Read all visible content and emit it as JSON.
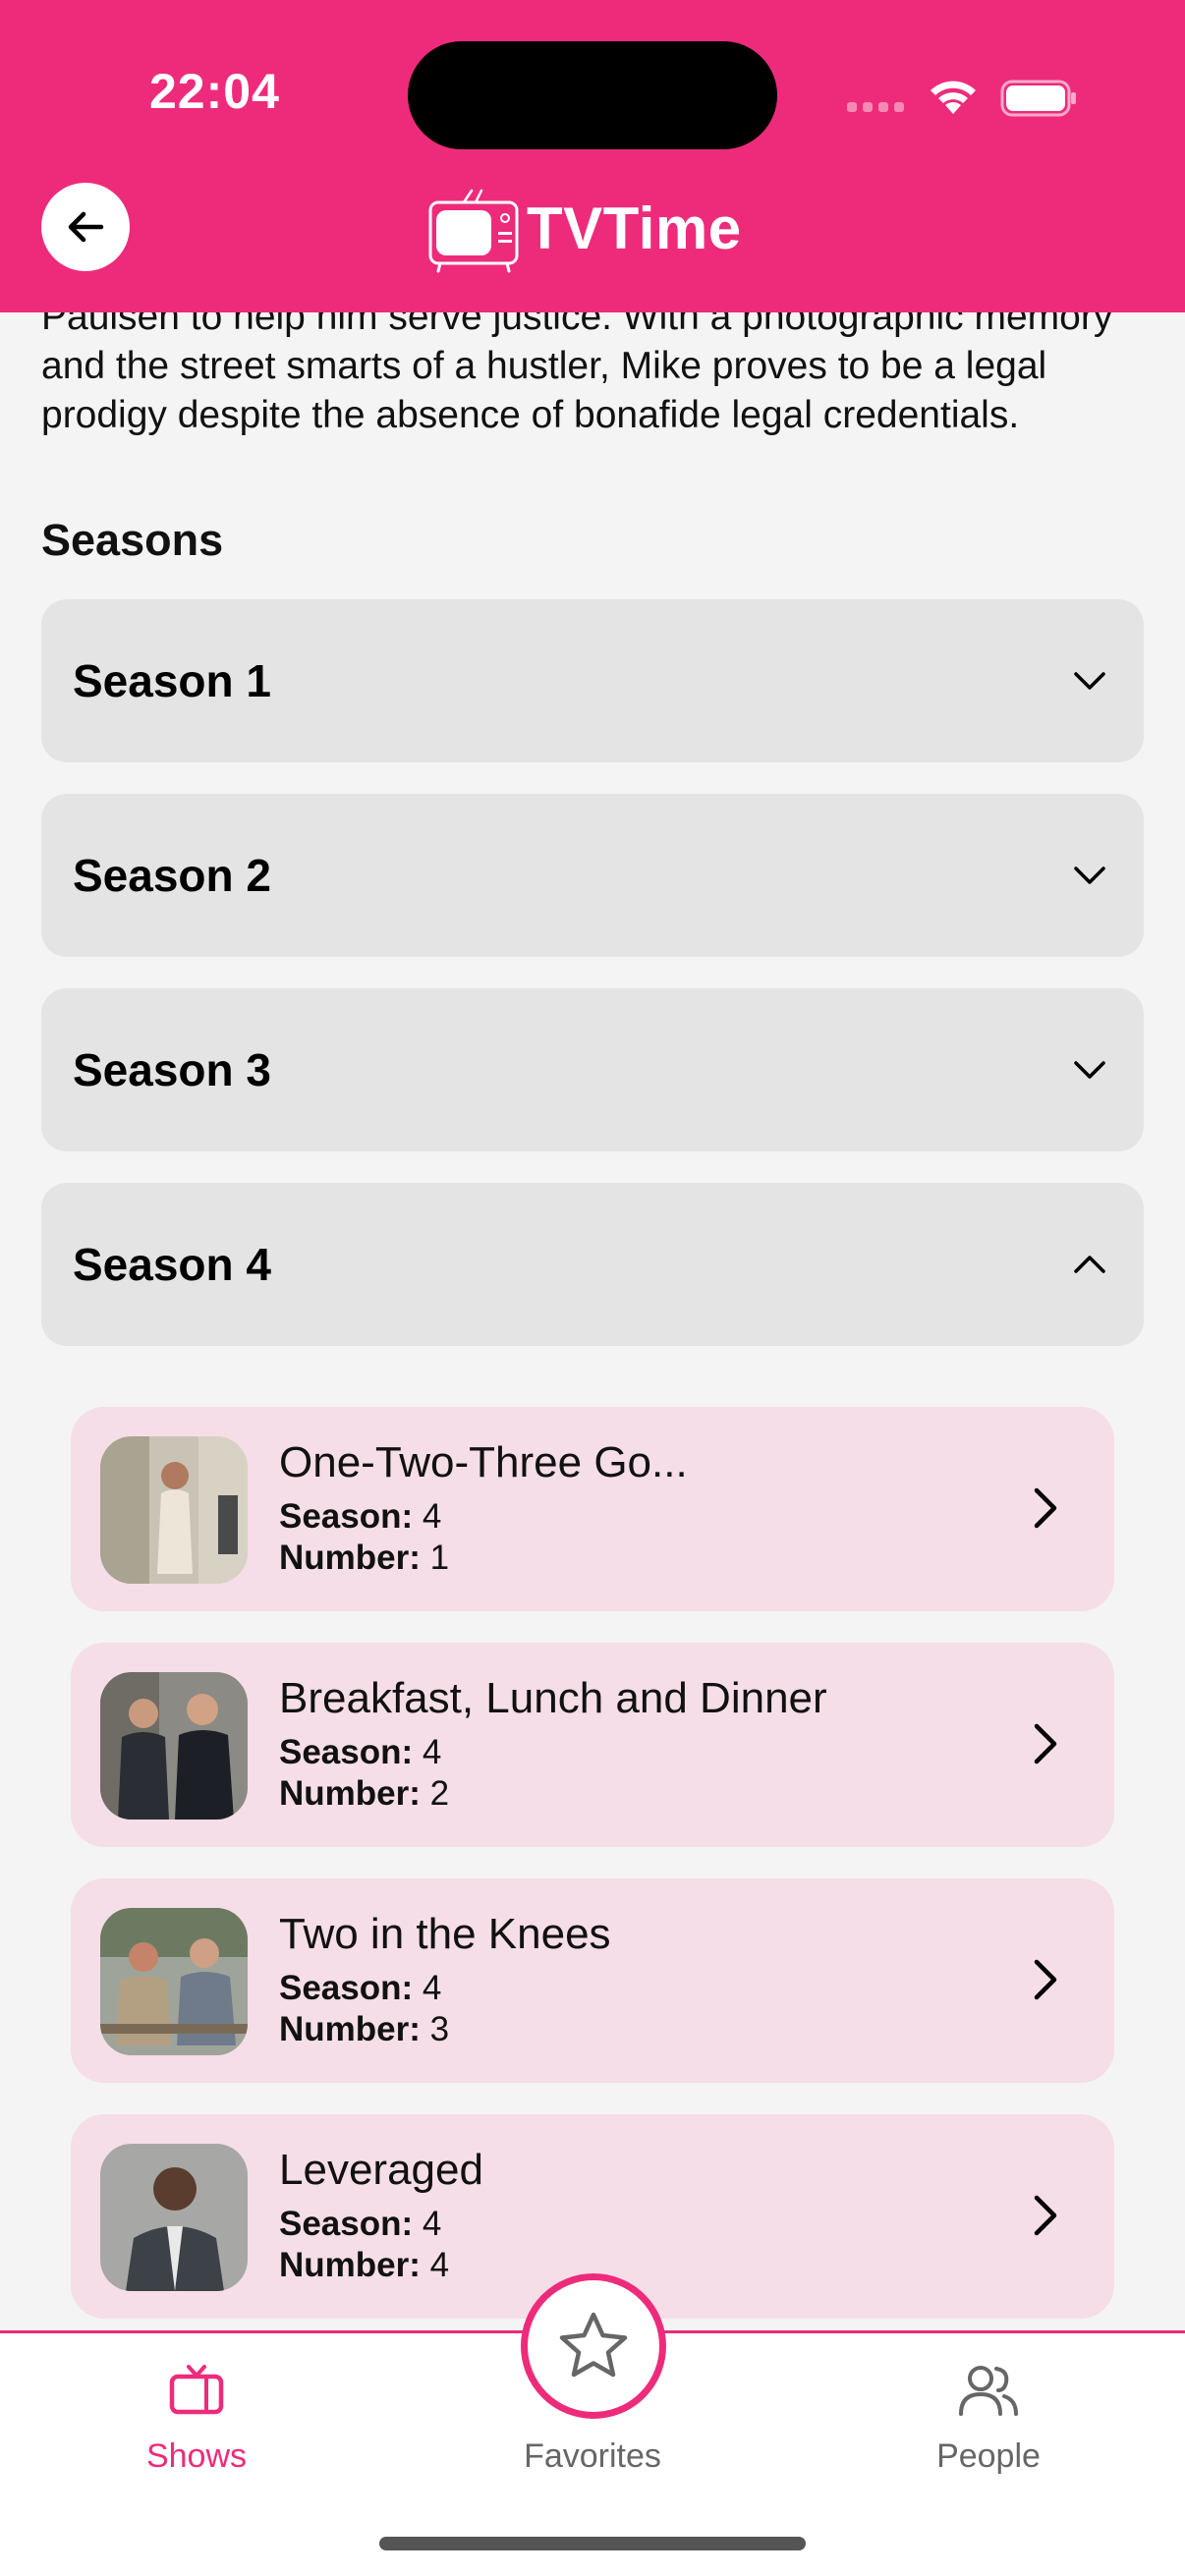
{
  "status_bar": {
    "time": "22:04"
  },
  "header": {
    "app_title": "TVTime",
    "accent_color": "#ee2b7b"
  },
  "description": "Paulsen to help him serve justice. With a photographic memory and the street smarts of a hustler, Mike proves to be a legal prodigy despite the absence of bonafide legal credentials.",
  "seasons": {
    "title": "Seasons",
    "items": [
      {
        "label": "Season 1",
        "expanded": false
      },
      {
        "label": "Season 2",
        "expanded": false
      },
      {
        "label": "Season 3",
        "expanded": false
      },
      {
        "label": "Season 4",
        "expanded": true
      }
    ]
  },
  "episode_labels": {
    "season": "Season:",
    "number": "Number:"
  },
  "episodes": [
    {
      "title": "One-Two-Three Go...",
      "season": "4",
      "number": "1"
    },
    {
      "title": "Breakfast, Lunch and Dinner",
      "season": "4",
      "number": "2"
    },
    {
      "title": "Two in the Knees",
      "season": "4",
      "number": "3"
    },
    {
      "title": "Leveraged",
      "season": "4",
      "number": "4"
    }
  ],
  "bottom_nav": {
    "shows": "Shows",
    "favorites": "Favorites",
    "people": "People",
    "active": "shows"
  }
}
